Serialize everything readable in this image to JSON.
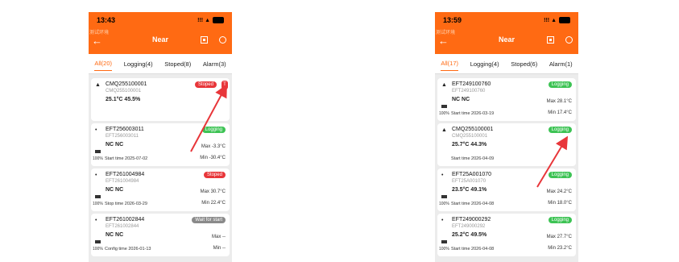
{
  "left": {
    "status": {
      "time": "13:43",
      "signal": "!!! ▲"
    },
    "nav": {
      "tiny": "测试环境",
      "title": "Near"
    },
    "tabs": [
      "All(20)",
      "Logging(4)",
      "Stoped(8)",
      "Alarm(3)"
    ],
    "cards": [
      {
        "name": "CMQ255100001",
        "sub": "CMQ255100001",
        "reading": "25.1°C  45.5%",
        "badge": "Stoped",
        "max": "",
        "min": "",
        "pct": "",
        "time": ""
      },
      {
        "name": "EFT256003011",
        "sub": "EFT256003011",
        "reading": "NC  NC",
        "badge": "Logging",
        "max": "Max  -3.3°C",
        "min": "Min  -30.4°C",
        "pct": "100%",
        "time": "Start time  2025-07-02"
      },
      {
        "name": "EFT261004984",
        "sub": "EFT261004984",
        "reading": "NC  NC",
        "badge": "Stoped",
        "max": "Max  30.7°C",
        "min": "Min  22.4°C",
        "pct": "100%",
        "time": "Stop time  2026-03-29"
      },
      {
        "name": "EFT261002844",
        "sub": "EFT261002844",
        "reading": "NC  NC",
        "badge": "Wait for start",
        "max": "Max  --",
        "min": "Min  --",
        "pct": "100%",
        "time": "Config time  2026-01-13"
      }
    ]
  },
  "right": {
    "status": {
      "time": "13:59",
      "signal": "!!! ▲"
    },
    "nav": {
      "tiny": "测试环境",
      "title": "Near"
    },
    "tabs": [
      "All(17)",
      "Logging(4)",
      "Stoped(6)",
      "Alarm(1)"
    ],
    "cards": [
      {
        "name": "EFT249100760",
        "sub": "EFT249100760",
        "reading": "NC  NC",
        "badge": "Logging",
        "max": "Max  28.1°C",
        "min": "Min  17.4°C",
        "pct": "100%",
        "time": "Start time  2026-03-19"
      },
      {
        "name": "CMQ255100001",
        "sub": "CMQ255100001",
        "reading": "25.7°C  44.3%",
        "badge": "Logging",
        "max": "",
        "min": "",
        "pct": "",
        "time": "Start time  2026-04-09"
      },
      {
        "name": "EFT25A001070",
        "sub": "EFT25A001070",
        "reading": "23.5°C  49.1%",
        "badge": "Logging",
        "max": "Max  24.2°C",
        "min": "Min  18.0°C",
        "pct": "100%",
        "time": "Start time  2026-04-08"
      },
      {
        "name": "EFT249000292",
        "sub": "EFT249000292",
        "reading": "25.2°C  49.5%",
        "badge": "Logging",
        "max": "Max  27.7°C",
        "min": "Min  23.2°C",
        "pct": "100%",
        "time": "Start time  2026-04-08"
      }
    ]
  },
  "colors": {
    "accent": "#ff6a13",
    "logging": "#3dc354",
    "stoped": "#e8363a",
    "wait": "#8a8a8a",
    "arrow": "#e8363a"
  },
  "icons": {
    "back": "←",
    "wifi": "wifi-icon",
    "scan": "scan-icon",
    "refresh": "refresh-icon"
  }
}
